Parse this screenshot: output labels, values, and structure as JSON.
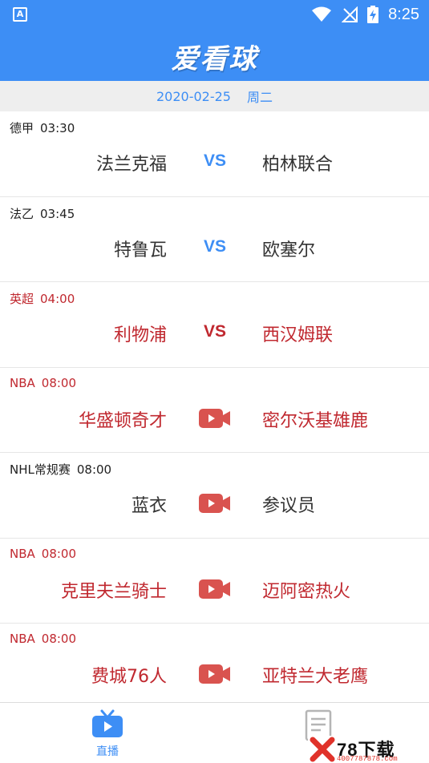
{
  "status_bar": {
    "time": "8:25",
    "badge_letter": "A",
    "icons": [
      "wifi-icon",
      "no-signal-icon",
      "battery-charging-icon"
    ]
  },
  "header": {
    "title": "爱看球"
  },
  "date_bar": {
    "date": "2020-02-25",
    "weekday": "周二"
  },
  "matches": [
    {
      "league": "德甲",
      "time": "03:30",
      "home": "法兰克福",
      "away": "柏林联合",
      "middle": "VS",
      "highlight": false
    },
    {
      "league": "法乙",
      "time": "03:45",
      "home": "特鲁瓦",
      "away": "欧塞尔",
      "middle": "VS",
      "highlight": false
    },
    {
      "league": "英超",
      "time": "04:00",
      "home": "利物浦",
      "away": "西汉姆联",
      "middle": "VS",
      "highlight": true
    },
    {
      "league": "NBA",
      "time": "08:00",
      "home": "华盛顿奇才",
      "away": "密尔沃基雄鹿",
      "middle": "video-camera-icon",
      "highlight": true
    },
    {
      "league": "NHL常规赛",
      "time": "08:00",
      "home": "蓝衣",
      "away": "参议员",
      "middle": "video-camera-icon",
      "highlight": false
    },
    {
      "league": "NBA",
      "time": "08:00",
      "home": "克里夫兰骑士",
      "away": "迈阿密热火",
      "middle": "video-camera-icon",
      "highlight": true
    },
    {
      "league": "NBA",
      "time": "08:00",
      "home": "费城76人",
      "away": "亚特兰大老鹰",
      "middle": "video-camera-icon",
      "highlight": true
    }
  ],
  "bottom_nav": {
    "live_label": "直播",
    "news_icon": "document-icon"
  },
  "watermark": {
    "text": "78下载",
    "sub": "4007787878.com"
  },
  "colors": {
    "primary": "#3d8ef5",
    "highlight_red": "#c0282f",
    "camera": "#d9534f"
  }
}
